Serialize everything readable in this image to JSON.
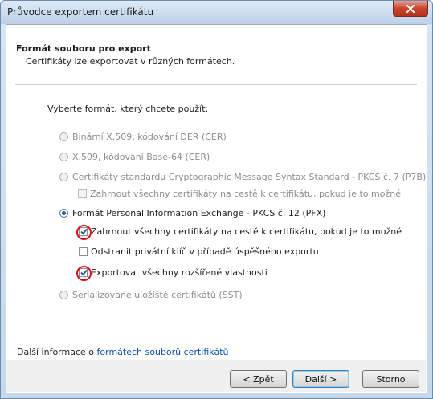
{
  "window": {
    "title": "Průvodce exportem certifikátu"
  },
  "header": {
    "title": "Formát souboru pro export",
    "subtitle": "Certifikáty lze exportovat v různých formátech."
  },
  "prompt": "Vyberte formát, který chcete použít:",
  "options": {
    "der": "Binární X.509, kódování DER (CER)",
    "base64": "X.509, kódování Base-64 (CER)",
    "p7b": "Certifikáty standardu Cryptographic Message Syntax Standard - PKCS č. 7 (P7B)",
    "p7b_include": "Zahrnout všechny certifikáty na cestě k certifikátu, pokud je to možné",
    "pfx": "Formát Personal Information Exchange - PKCS č. 12 (PFX)",
    "pfx_include": "Zahrnout všechny certifikáty na cestě k certifikátu, pokud je to možné",
    "pfx_delete_key": "Odstranit privátní klíč v případě úspěšného exportu",
    "pfx_export_props": "Exportovat všechny rozšířené vlastnosti",
    "sst": "Serializované úložiště certifikátů (SST)"
  },
  "more_info": {
    "prefix": "Další informace o ",
    "link": "formátech souborů certifikátů"
  },
  "buttons": {
    "back": "< Zpět",
    "next": "Další >",
    "cancel": "Storno"
  },
  "state": {
    "selected_format": "pfx",
    "pfx_include_checked": true,
    "pfx_delete_key_checked": false,
    "pfx_export_props_checked": true
  },
  "colors": {
    "highlight_ring": "#d2121b",
    "link": "#0a4fa8"
  }
}
